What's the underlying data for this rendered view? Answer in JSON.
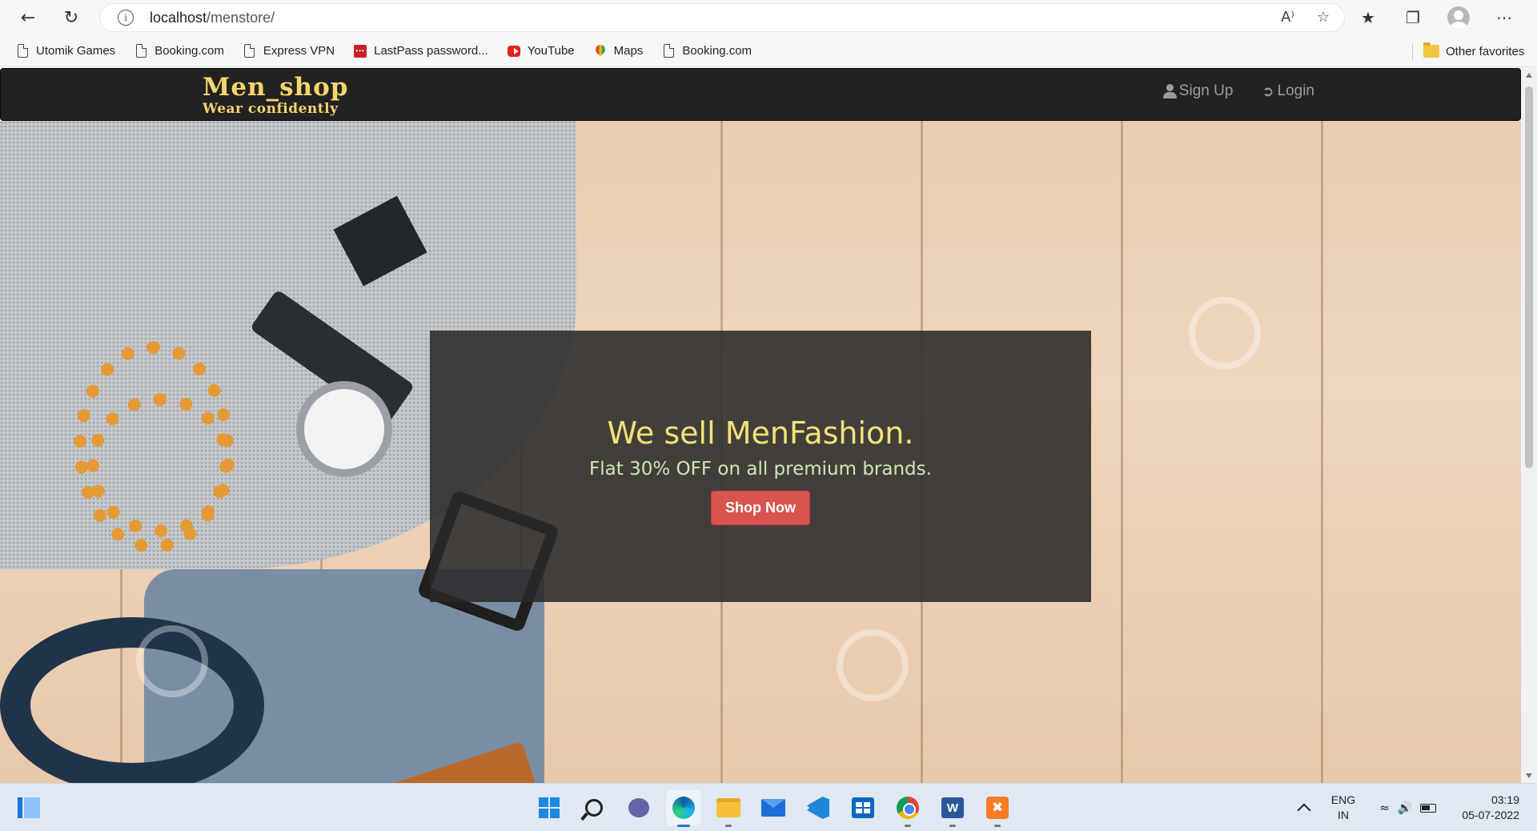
{
  "browser": {
    "url_host": "localhost",
    "url_path": "/menstore/",
    "read_aloud_label": "A⁾"
  },
  "bookmarks": [
    {
      "label": "Utomik Games",
      "icon": "page-icon"
    },
    {
      "label": "Booking.com",
      "icon": "page-icon"
    },
    {
      "label": "Express VPN",
      "icon": "page-icon"
    },
    {
      "label": "LastPass password...",
      "icon": "lastpass-icon"
    },
    {
      "label": "YouTube",
      "icon": "youtube-icon"
    },
    {
      "label": "Maps",
      "icon": "maps-icon"
    },
    {
      "label": "Booking.com",
      "icon": "page-icon"
    }
  ],
  "other_favorites": "Other favorites",
  "site": {
    "brand_name": "Men_shop",
    "brand_tagline": "Wear confidently",
    "nav": {
      "signup_label": "Sign Up",
      "login_label": "Login"
    },
    "hero": {
      "title": "We sell MenFashion.",
      "subtitle": "Flat 30% OFF on all premium brands.",
      "cta_label": "Shop Now"
    }
  },
  "colors": {
    "brand_gold": "#f5d66b",
    "navbar_bg": "#222222",
    "cta_red": "#d9534f",
    "hero_title": "#f5e27a",
    "hero_sub": "#cde7b4"
  },
  "taskbar": {
    "apps": [
      "start",
      "search",
      "teams-chat",
      "edge",
      "file-explorer",
      "mail",
      "vscode",
      "microsoft-store",
      "chrome",
      "word",
      "xampp"
    ],
    "lang_line1": "ENG",
    "lang_line2": "IN",
    "time": "03:19",
    "date": "05-07-2022"
  }
}
